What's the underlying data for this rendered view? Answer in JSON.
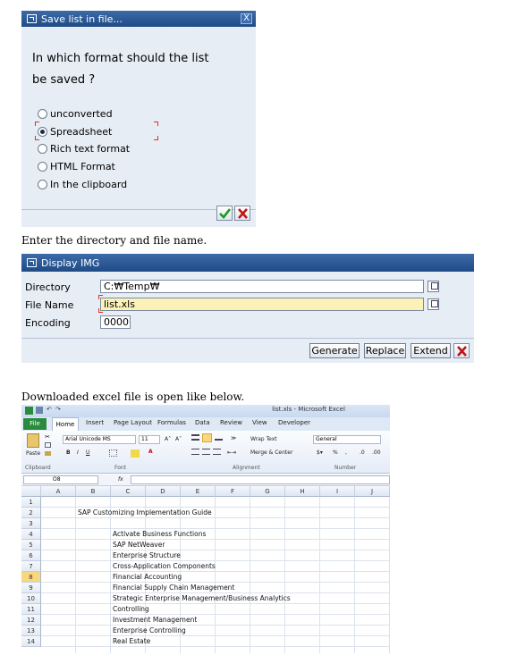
{
  "dialog1": {
    "title": "Save list in file...",
    "close": "X",
    "question_line1": "In which format should the list",
    "question_line2": "be saved ?",
    "options": [
      {
        "label": "unconverted",
        "selected": false
      },
      {
        "label": "Spreadsheet",
        "selected": true
      },
      {
        "label": "Rich text format",
        "selected": false
      },
      {
        "label": "HTML Format",
        "selected": false
      },
      {
        "label": "In the clipboard",
        "selected": false
      }
    ]
  },
  "caption1": "Enter the directory and file name.",
  "dialog2": {
    "title": "Display IMG",
    "fields": [
      {
        "label": "Directory",
        "value": "C:₩Temp₩"
      },
      {
        "label": "File Name",
        "value": "list.xls"
      },
      {
        "label": "Encoding",
        "value": "0000"
      }
    ],
    "buttons": {
      "generate": "Generate",
      "replace": "Replace",
      "extend": "Extend"
    }
  },
  "caption2": "Downloaded excel file is open like below.",
  "excel": {
    "window_title": "list.xls - Microsoft Excel",
    "tabs": [
      "File",
      "Home",
      "Insert",
      "Page Layout",
      "Formulas",
      "Data",
      "Review",
      "View",
      "Developer"
    ],
    "ribbon": {
      "paste": "Paste",
      "font_name": "Arial Unicode MS",
      "font_size": "11",
      "wrap_text": "Wrap Text",
      "merge_center": "Merge & Center",
      "number_format": "General",
      "groups": [
        "Clipboard",
        "Font",
        "Alignment",
        "Number"
      ]
    },
    "name_box": "O8",
    "fx": "fx",
    "columns": [
      "A",
      "B",
      "C",
      "D",
      "E",
      "F",
      "G",
      "H",
      "I",
      "J"
    ],
    "rows": [
      "1",
      "2",
      "3",
      "4",
      "5",
      "6",
      "7",
      "8",
      "9",
      "10",
      "11",
      "12",
      "13",
      "14"
    ],
    "selected_row": "8",
    "title_cell": "SAP Customizing Implementation Guide",
    "items": [
      "Activate Business Functions",
      "SAP NetWeaver",
      "Enterprise Structure",
      "Cross-Application Components",
      "Financial Accounting",
      "Financial Supply Chain Management",
      "Strategic Enterprise Management/Business Analytics",
      "Controlling",
      "Investment Management",
      "Enterprise Controlling",
      "Real Estate"
    ]
  }
}
